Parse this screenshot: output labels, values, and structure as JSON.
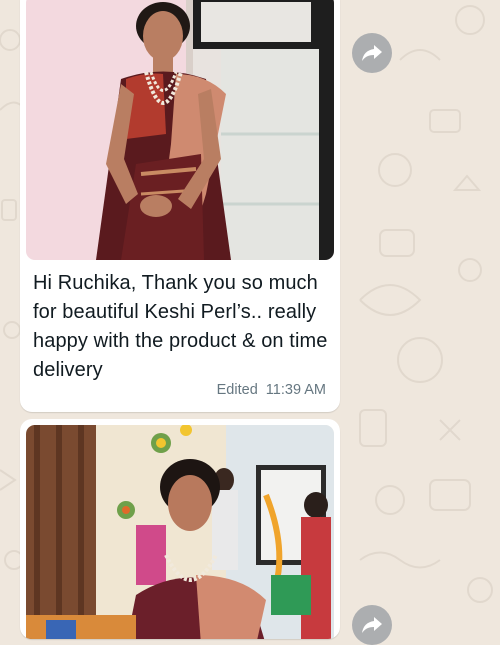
{
  "messages": [
    {
      "type": "image",
      "has_caption": true,
      "caption": "Hi Ruchika, Thank you so much for beautiful Keshi Perl’s.. really happy with the product & on time delivery",
      "edited_label": "Edited",
      "time": "11:39 AM"
    },
    {
      "type": "image",
      "has_caption": false
    }
  ],
  "icons": {
    "forward": "forward-arrow-icon"
  },
  "colors": {
    "chat_background": "#efe7dd",
    "bubble": "#ffffff",
    "text": "#111b21",
    "meta": "#667781",
    "forward_button": "#a0a3a8"
  }
}
